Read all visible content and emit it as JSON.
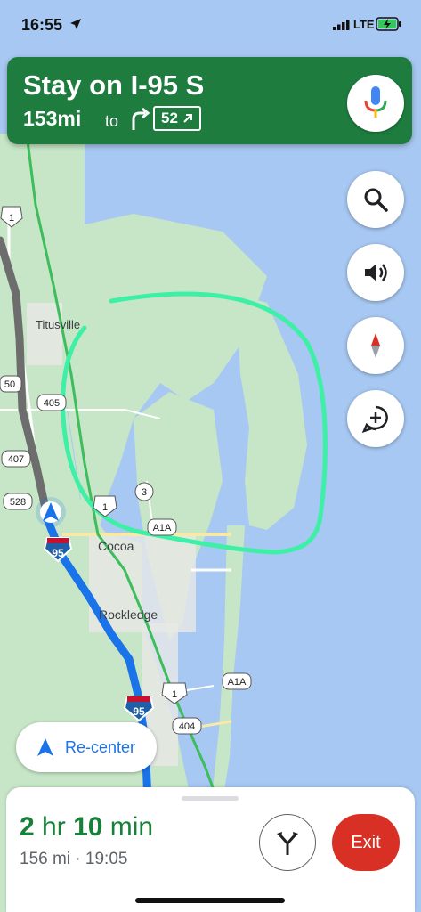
{
  "status_bar": {
    "time": "16:55",
    "network": "LTE"
  },
  "nav_banner": {
    "instruction": "Stay on I-95 S",
    "distance": "153mi",
    "to_label": "to",
    "exit_number": "52"
  },
  "map": {
    "places": [
      "Titusville",
      "Cocoa",
      "Rockledge"
    ],
    "route_shields": [
      "95",
      "95"
    ],
    "road_shields": [
      "1",
      "1",
      "1",
      "50",
      "405",
      "407",
      "528",
      "3",
      "A1A",
      "A1A",
      "404"
    ],
    "colors": {
      "route": "#1a73e8",
      "annotation": "#3ef0a6",
      "land": "#c7e6c7",
      "water": "#a7c8f2"
    }
  },
  "controls": {
    "recenter_label": "Re-center"
  },
  "trip_sheet": {
    "eta_hours": "2",
    "eta_hr_label": "hr",
    "eta_minutes": "10",
    "eta_min_label": "min",
    "summary": "156 mi · 19:05",
    "exit_label": "Exit"
  }
}
